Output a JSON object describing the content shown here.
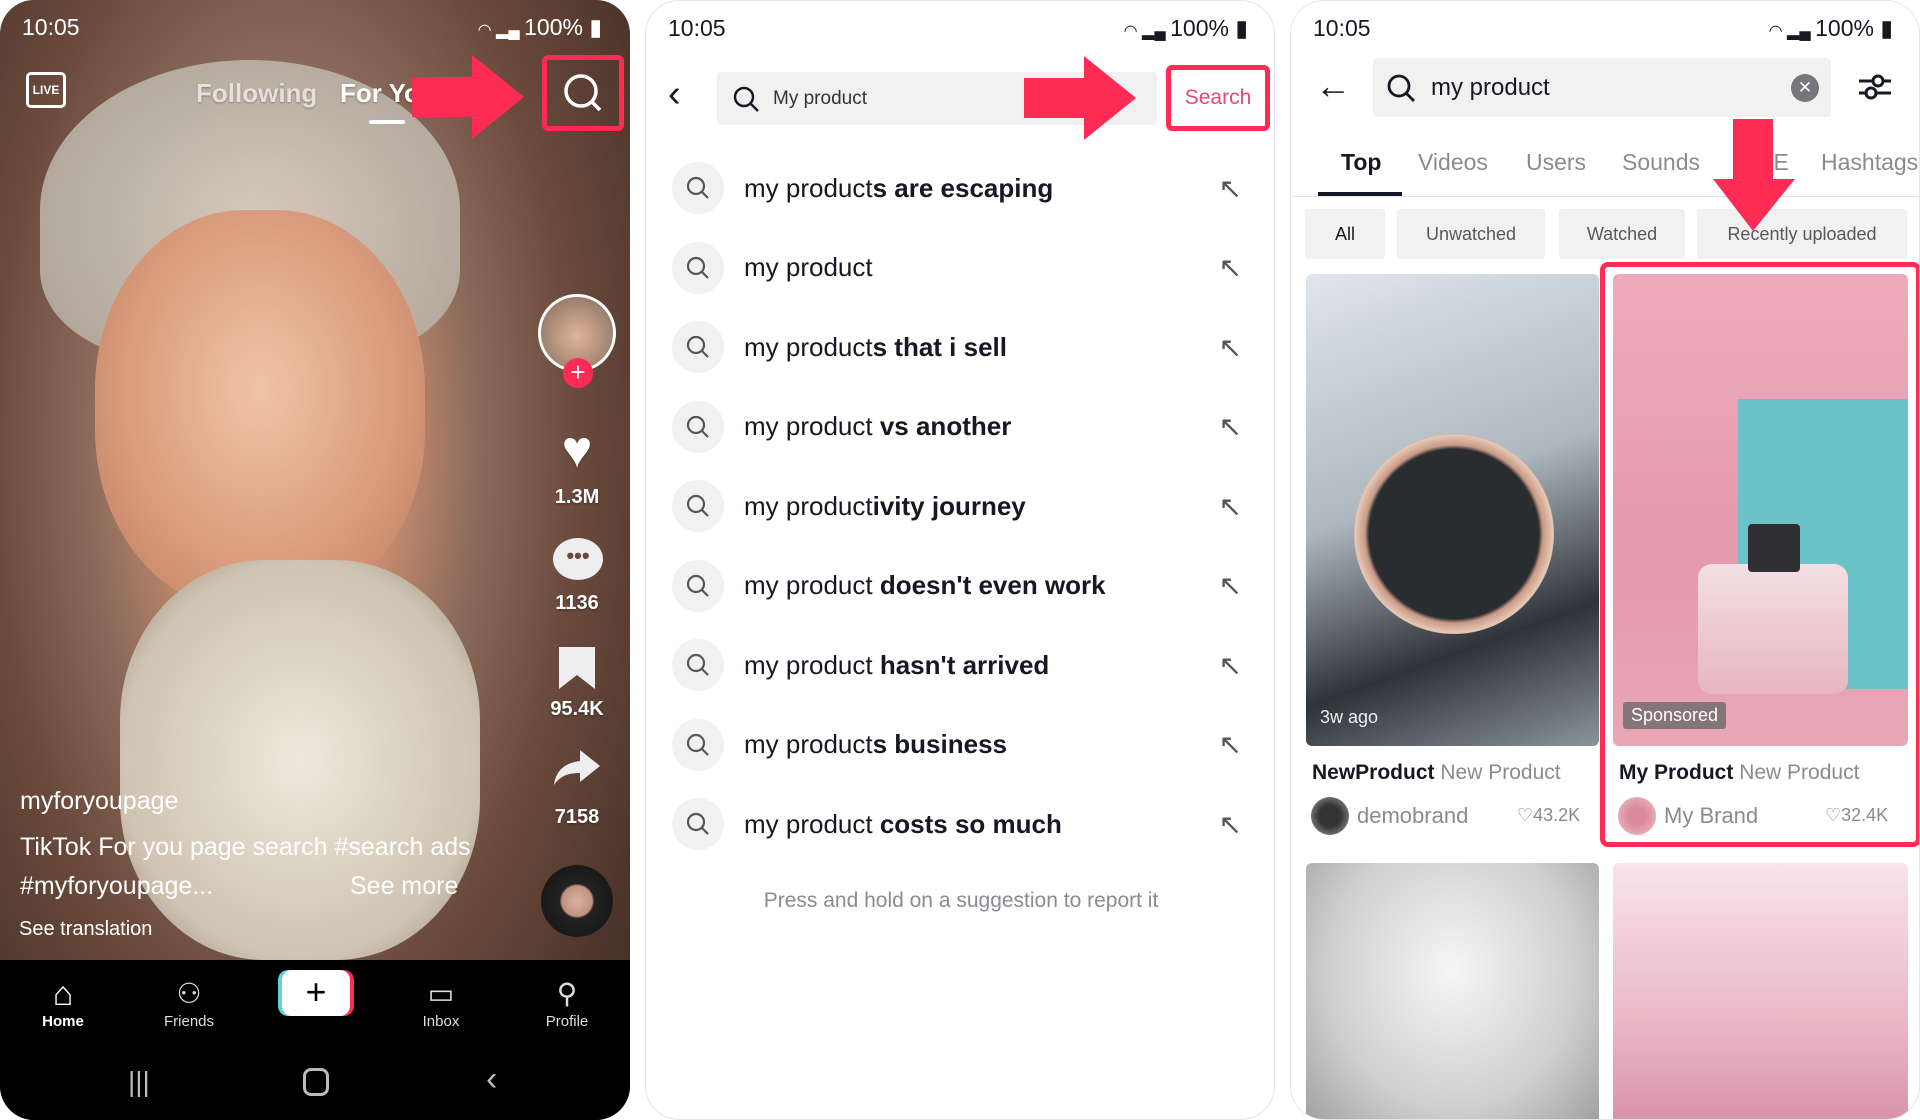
{
  "status": {
    "time": "10:05",
    "battery": "100%"
  },
  "feed": {
    "live": "LIVE",
    "tabs": [
      "Following",
      "For You"
    ],
    "likes": "1.3M",
    "comments": "1136",
    "saves": "95.4K",
    "shares": "7158",
    "username": "myforyoupage",
    "caption_line1": "TikTok For you page search #search ads",
    "caption_line2": "#myforyoupage...",
    "see_more": "See more",
    "see_translation": "See translation",
    "nav": [
      "Home",
      "Friends",
      "Inbox",
      "Profile"
    ],
    "create": "+"
  },
  "suggest": {
    "query": "My product",
    "search_label": "Search",
    "items": [
      {
        "prefix": "my product",
        "rest": "s are escaping"
      },
      {
        "prefix": "my product",
        "rest": ""
      },
      {
        "prefix": "my product",
        "rest": "s that i sell"
      },
      {
        "prefix": "my product",
        "rest": " vs another"
      },
      {
        "prefix": "my product",
        "rest": "ivity journey"
      },
      {
        "prefix": "my product",
        "rest": " doesn't even work"
      },
      {
        "prefix": "my product",
        "rest": " hasn't arrived"
      },
      {
        "prefix": "my product",
        "rest": "s business"
      },
      {
        "prefix": "my product",
        "rest": " costs so much"
      }
    ],
    "footer": "Press and hold on a suggestion to report it"
  },
  "results": {
    "query": "my product",
    "tabs": [
      "Top",
      "Videos",
      "Users",
      "Sounds",
      "LIVE",
      "Hashtags"
    ],
    "chips": [
      "All",
      "Unwatched",
      "Watched",
      "Recently uploaded"
    ],
    "cards": [
      {
        "badge": "3w ago",
        "title": "NewProduct",
        "subtitle": "New Product",
        "author": "demobrand",
        "likes": "43.2K"
      },
      {
        "badge": "Sponsored",
        "title": "My Product",
        "subtitle": "New Product",
        "author": "My Brand",
        "likes": "32.4K"
      }
    ]
  },
  "colors": {
    "accent": "#fe2c55"
  }
}
